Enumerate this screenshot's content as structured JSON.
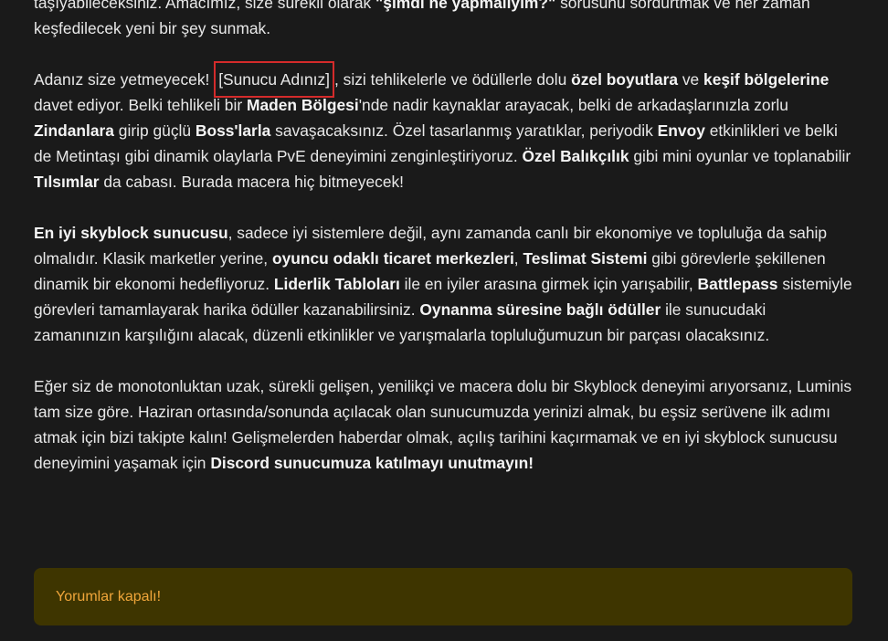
{
  "article": {
    "p0": {
      "t1": "taşıyabileceksiniz. Amacımız, size sürekli olarak ",
      "b1": "\"şimdi ne yapmalıyım?\"",
      "t2": " sorusunu sordurtmak ve her zaman keşfedilecek yeni bir şey sunmak."
    },
    "p1": {
      "t1": "Adanız size yetmeyecek! ",
      "highlight": "[Sunucu Adınız]",
      "t2": ", sizi tehlikelerle ve ödüllerle dolu ",
      "b1": "özel boyutlara",
      "t3": " ve ",
      "b2": "keşif bölgelerine",
      "t4": " davet ediyor. Belki tehlikeli bir ",
      "b3": "Maden Bölgesi",
      "t5": "'nde nadir kaynaklar arayacak, belki de arkadaşlarınızla zorlu ",
      "b4": "Zindanlara",
      "t6": " girip güçlü ",
      "b5": "Boss'larla",
      "t7": " savaşacaksınız. Özel tasarlanmış yaratıklar, periyodik ",
      "b6": "Envoy",
      "t8": " etkinlikleri ve belki de Metintaşı gibi dinamik olaylarla PvE deneyimini zenginleştiriyoruz. ",
      "b7": "Özel Balıkçılık",
      "t9": " gibi mini oyunlar ve toplanabilir ",
      "b8": "Tılsımlar",
      "t10": " da cabası. Burada macera hiç bitmeyecek!"
    },
    "p2": {
      "b1": "En iyi skyblock sunucusu",
      "t1": ", sadece iyi sistemlere değil, aynı zamanda canlı bir ekonomiye ve topluluğa da sahip olmalıdır. Klasik marketler yerine, ",
      "b2": "oyuncu odaklı ticaret merkezleri",
      "t2": ", ",
      "b3": "Teslimat Sistemi",
      "t3": " gibi görevlerle şekillenen dinamik bir ekonomi hedefliyoruz. ",
      "b4": "Liderlik Tabloları",
      "t4": " ile en iyiler arasına girmek için yarışabilir, ",
      "b5": "Battlepass",
      "t5": " sistemiyle görevleri tamamlayarak harika ödüller kazanabilirsiniz. ",
      "b6": "Oynanma süresine bağlı ödüller",
      "t6": " ile sunucudaki zamanınızın karşılığını alacak, düzenli etkinlikler ve yarışmalarla topluluğumuzun bir parçası olacaksınız."
    },
    "p3": {
      "t1": "Eğer siz de monotonluktan uzak, sürekli gelişen, yenilikçi ve macera dolu bir Skyblock deneyimi arıyorsanız, Luminis tam size göre. Haziran ortasında/sonunda açılacak olan sunucumuzda yerinizi almak, bu eşsiz serüvene ilk adımı atmak için bizi takipte kalın! Gelişmelerden haberdar olmak, açılış tarihini kaçırmamak ve en iyi skyblock sunucusu deneyimini yaşamak için ",
      "b1": "Discord sunucumuza katılmayı unutmayın!"
    }
  },
  "notice": {
    "text": "Yorumlar kapalı!"
  },
  "colors": {
    "background": "#1a1a1a",
    "text": "#e8e8e8",
    "highlight_border": "#d42b2b",
    "notice_bg": "#3e3500",
    "notice_text": "#f0a63a"
  }
}
